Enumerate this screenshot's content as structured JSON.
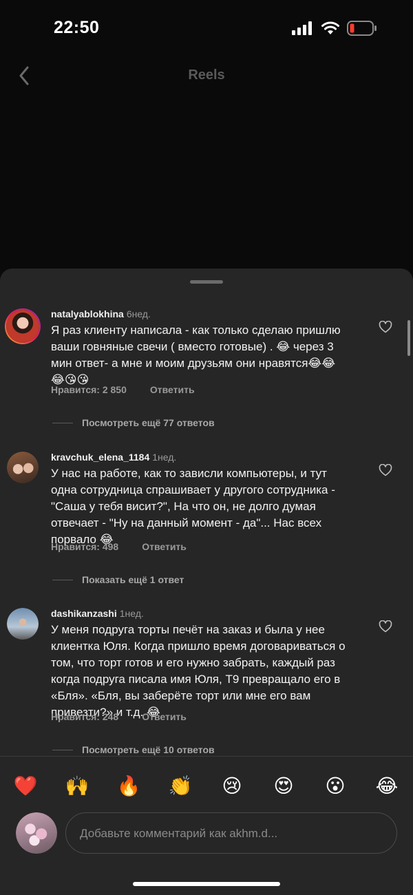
{
  "status_bar": {
    "time": "22:50"
  },
  "header": {
    "title": "Reels"
  },
  "comments": [
    {
      "username": "natalyablokhina",
      "time": "6нед.",
      "text": "Я раз клиенту написала - как только сделаю пришлю\nваши говняные свечи ( вместо готовые) . 😂 через 3\nмин ответ- а мне и моим друзьям они нравятся😂😂\n😂😘😘",
      "likes": "Нравится: 2 850",
      "reply": "Ответить",
      "replies": "Посмотреть ещё 77 ответов"
    },
    {
      "username": "kravchuk_elena_1184",
      "time": "1нед.",
      "text": "У нас на работе, как то зависли компьютеры, и тут\nодна сотрудница спрашивает у другого сотрудника -\n\"Саша у тебя висит?\", На что он, не долго думая\nотвечает - \"Ну на данный момент - да\"... Нас всех\nпорвало 😂",
      "likes": "Нравится: 498",
      "reply": "Ответить",
      "replies": "Показать ещё 1 ответ"
    },
    {
      "username": "dashikanzashi",
      "time": "1нед.",
      "text": "У меня подруга торты печёт на заказ и была у нее\nклиентка Юля. Когда пришло время договариваться о\nтом, что торт готов и его нужно забрать, каждый раз\nкогда подруга писала имя Юля, Т9 превращало его в\n«Бля». «Бля, вы заберёте торт или мне его вам\nпривезти?» и т.д. 😂",
      "likes": "Нравится: 248",
      "reply": "Ответить",
      "replies": "Посмотреть ещё 10 ответов"
    }
  ],
  "emoji_bar": [
    "❤️",
    "🙌",
    "🔥",
    "👏",
    "😢",
    "😍",
    "😮",
    "😂"
  ],
  "input": {
    "placeholder": "Добавьте комментарий как akhm.d..."
  },
  "colors": {
    "sheet": "#262626",
    "background": "#0a0a0a",
    "muted": "#9a9a9a"
  }
}
